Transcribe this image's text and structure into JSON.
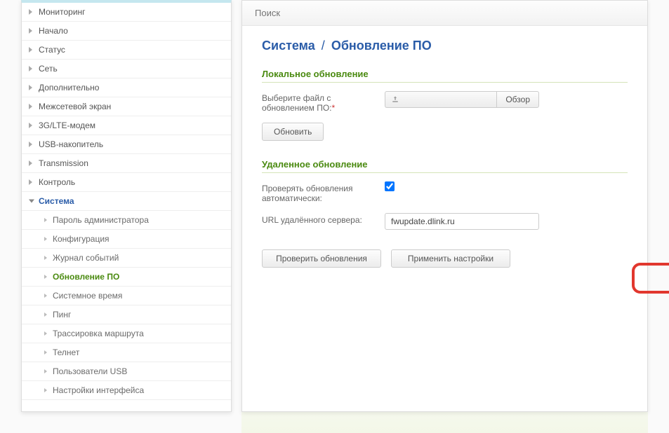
{
  "search": {
    "placeholder": "Поиск"
  },
  "sidebar": {
    "items": [
      {
        "label": "Мониторинг"
      },
      {
        "label": "Начало"
      },
      {
        "label": "Статус"
      },
      {
        "label": "Сеть"
      },
      {
        "label": "Дополнительно"
      },
      {
        "label": "Межсетевой экран"
      },
      {
        "label": "3G/LTE-модем"
      },
      {
        "label": "USB-накопитель"
      },
      {
        "label": "Transmission"
      },
      {
        "label": "Контроль"
      },
      {
        "label": "Система"
      }
    ],
    "system_children": [
      {
        "label": "Пароль администратора"
      },
      {
        "label": "Конфигурация"
      },
      {
        "label": "Журнал событий"
      },
      {
        "label": "Обновление ПО"
      },
      {
        "label": "Системное время"
      },
      {
        "label": "Пинг"
      },
      {
        "label": "Трассировка маршрута"
      },
      {
        "label": "Телнет"
      },
      {
        "label": "Пользователи USB"
      },
      {
        "label": "Настройки интерфейса"
      }
    ]
  },
  "breadcrumb": {
    "root": "Система",
    "sep": "/",
    "page": "Обновление ПО"
  },
  "sections": {
    "local": {
      "title": "Локальное обновление",
      "file_label": "Выберите файл с обновлением ПО:",
      "required_mark": "*",
      "browse": "Обзор",
      "update": "Обновить"
    },
    "remote": {
      "title": "Удаленное обновление",
      "auto_label": "Проверять обновления автоматически:",
      "auto_checked": true,
      "url_label": "URL удалённого сервера:",
      "url_value": "fwupdate.dlink.ru"
    }
  },
  "actions": {
    "check": "Проверить обновления",
    "apply": "Применить настройки"
  }
}
